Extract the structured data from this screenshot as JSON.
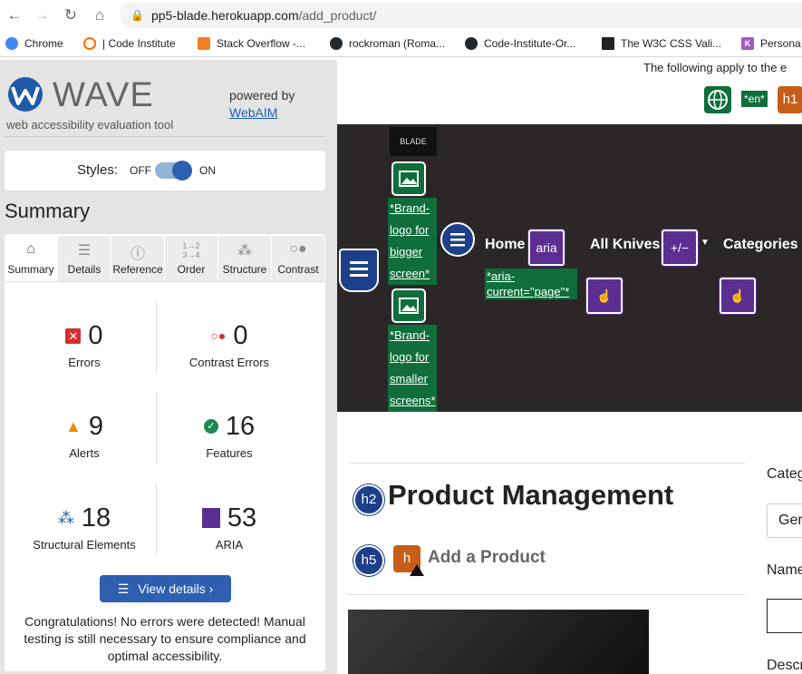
{
  "browser": {
    "url_host": "pp5-blade.herokuapp.com",
    "url_path": "/add_product/",
    "bookmarks": [
      {
        "label": "Chrome",
        "color": "#4285f4"
      },
      {
        "label": "| Code Institute",
        "color": "#ff6a00"
      },
      {
        "label": "Stack Overflow -...",
        "color": "#f48024"
      },
      {
        "label": "rockroman (Roma...",
        "color": "#24292e"
      },
      {
        "label": "Code-Institute-Or...",
        "color": "#24292e"
      },
      {
        "label": "The W3C CSS Vali...",
        "color": "#222"
      },
      {
        "label": "Persona",
        "color": "#a259c4"
      }
    ]
  },
  "wave": {
    "logo_text": "WAVE",
    "tagline": "web accessibility evaluation tool",
    "powered_by": "powered by",
    "webaim": "WebAIM",
    "styles_label": "Styles:",
    "off": "OFF",
    "on": "ON",
    "summary_heading": "Summary",
    "tabs": [
      "Summary",
      "Details",
      "Reference",
      "Order",
      "Structure",
      "Contrast"
    ],
    "stats": {
      "errors": {
        "num": "0",
        "label": "Errors"
      },
      "contrast": {
        "num": "0",
        "label": "Contrast Errors"
      },
      "alerts": {
        "num": "9",
        "label": "Alerts"
      },
      "features": {
        "num": "16",
        "label": "Features"
      },
      "structural": {
        "num": "18",
        "label": "Structural Elements"
      },
      "aria": {
        "num": "53",
        "label": "ARIA"
      }
    },
    "view_details": "View details ›",
    "congrats": "Congratulations! No errors were detected! Manual testing is still necessary to ensure compliance and optimal accessibility."
  },
  "page": {
    "apply_text": "The following apply to the e",
    "lang_tag": "*en*",
    "h1_tag": "h1",
    "brand_small": "BLADE",
    "brand_big_label": "*Brand-logo for bigger screen*",
    "brand_small_label": "*Brand-logo for smaller screens*",
    "nav_home": "Home",
    "nav_aria": "aria",
    "aria_current": "*aria-current=\"page\"*",
    "nav_all_knives": "All Knives",
    "nav_plusminus": "+/−",
    "nav_categories": "Categories",
    "h2_tag": "h2",
    "product_heading": "Product Management",
    "h5_tag": "h5",
    "h_tag": "h",
    "add_product": "Add a Product",
    "field_category": "Categ",
    "field_category_value": "Ger",
    "field_name": "Name",
    "field_desc": "Descr"
  }
}
